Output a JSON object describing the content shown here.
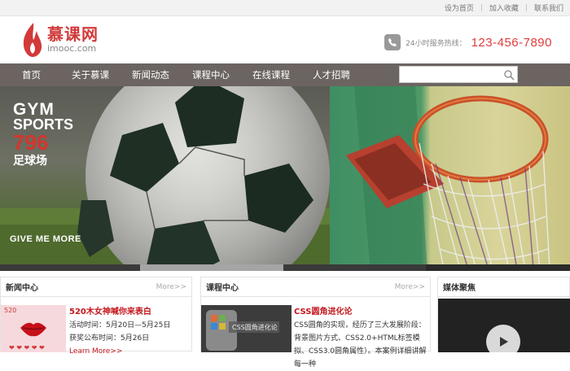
{
  "topbar": {
    "links": [
      "设为首页",
      "加入收藏",
      "联系我们"
    ]
  },
  "logo": {
    "name_cn": "慕课网",
    "name_en": "imooc.com"
  },
  "hotline": {
    "label": "24小时服务热线：",
    "number": "123-456-7890"
  },
  "nav": {
    "items": [
      "首页",
      "关于慕课",
      "新闻动态",
      "课程中心",
      "在线课程",
      "人才招聘"
    ]
  },
  "search": {
    "value": "",
    "placeholder": ""
  },
  "banner": {
    "left": {
      "line1": "GYM",
      "line2": "SPORTS",
      "line3": "796",
      "line4": "足球场",
      "slogan": "GIVE ME MORE"
    }
  },
  "panels": {
    "news": {
      "title": "新闻中心",
      "more": "More>>",
      "thumb_text": "520",
      "item_title": "520木女神喊你来表白",
      "time": "活动时间：5月20日—5月25日",
      "announce": "获奖公布时间：5月26日",
      "link": "Learn More>>"
    },
    "courses": {
      "title": "课程中心",
      "more": "More>>",
      "thumb_text": "CSS圆角进化论",
      "item_title": "CSS圆角进化论",
      "desc": "CSS圆角的实现，经历了三大发展阶段：背景图片方式、CSS2.0+HTML标签模拟、CSS3.0圆角属性）。本案例详细讲解每一种"
    },
    "media": {
      "title": "媒体聚焦"
    }
  },
  "colors": {
    "accent": "#d23a3a",
    "nav_bg": "#6b6461",
    "link_red": "#c4161c"
  }
}
